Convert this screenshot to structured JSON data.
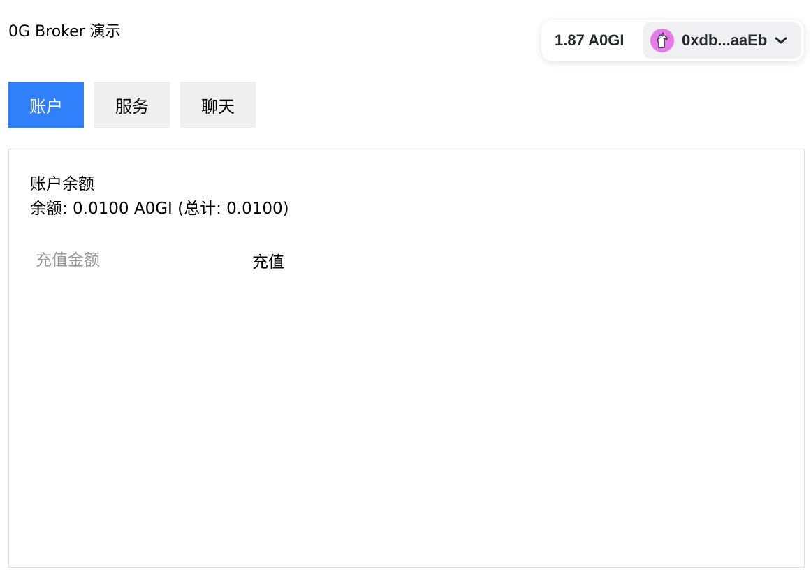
{
  "app": {
    "title": "0G Broker 演示"
  },
  "wallet": {
    "balance": "1.87 A0GI",
    "address": "0xdb...aaEb",
    "avatar_icon": "unicorn-icon",
    "avatar_color": "#e57be8",
    "chevron_icon": "chevron-down-icon"
  },
  "tabs": [
    {
      "label": "账户",
      "active": true
    },
    {
      "label": "服务",
      "active": false
    },
    {
      "label": "聊天",
      "active": false
    }
  ],
  "account": {
    "section_title": "账户余额",
    "balance_text": "余额: 0.0100 A0GI (总计: 0.0100)",
    "deposit_input": {
      "value": "",
      "placeholder": "充值金额"
    },
    "deposit_button_label": "充值"
  },
  "colors": {
    "accent": "#2f80fa",
    "tab_inactive": "#efefef",
    "panel_border": "#dedede"
  }
}
